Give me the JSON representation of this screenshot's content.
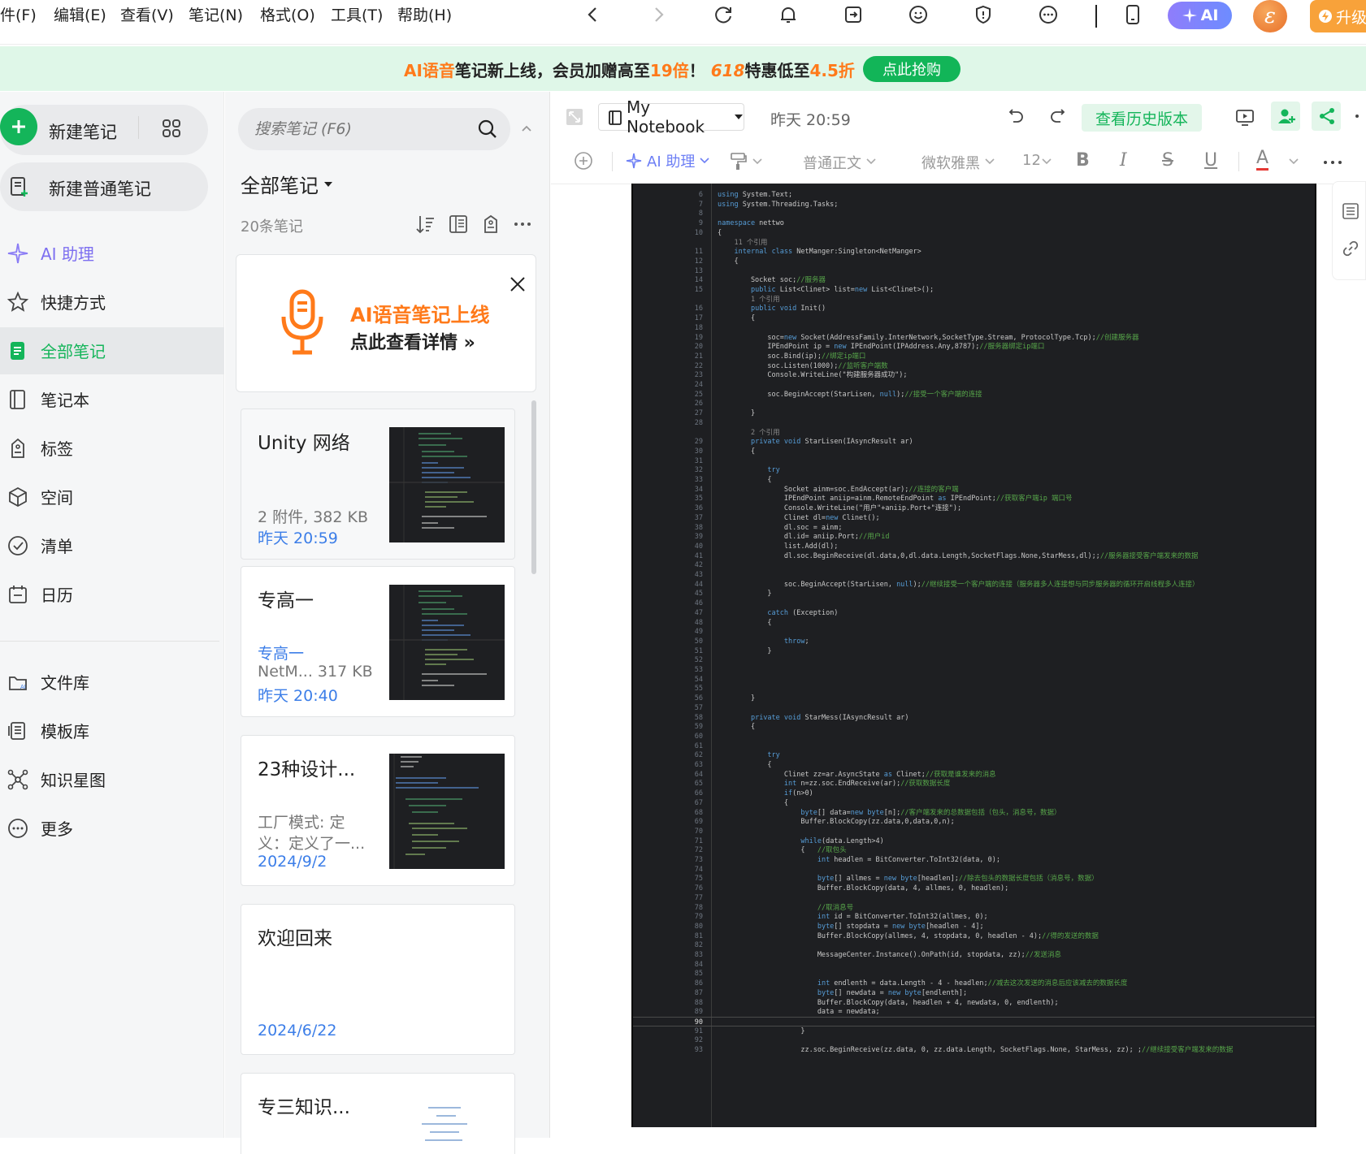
{
  "menubar": {
    "items": [
      "件(F)",
      "编辑(E)",
      "查看(V)",
      "笔记(N)",
      "格式(O)",
      "工具(T)",
      "帮助(H)"
    ],
    "ai_label": "AI",
    "avatar_letter": "ε",
    "upgrade_label": "升级"
  },
  "banner": {
    "part1": "AI语音",
    "part2": "笔记新上线，会员加赠高至",
    "part3": "19倍",
    "part4": "！",
    "part5": "618",
    "part6": "特惠低至",
    "part7": "4.5折",
    "button": "点此抢购"
  },
  "sidebar": {
    "new_note": "新建笔记",
    "new_plain_note": "新建普通笔记",
    "items": [
      {
        "label": "AI 助理",
        "icon": "sparkle-icon"
      },
      {
        "label": "快捷方式",
        "icon": "star-icon"
      },
      {
        "label": "全部笔记",
        "icon": "note-icon"
      },
      {
        "label": "笔记本",
        "icon": "notebook-icon"
      },
      {
        "label": "标签",
        "icon": "tag-icon"
      },
      {
        "label": "空间",
        "icon": "cube-icon"
      },
      {
        "label": "清单",
        "icon": "check-circle-icon"
      },
      {
        "label": "日历",
        "icon": "calendar-icon"
      },
      {
        "label": "文件库",
        "icon": "file-library-icon"
      },
      {
        "label": "模板库",
        "icon": "template-icon"
      },
      {
        "label": "知识星图",
        "icon": "knowledge-graph-icon"
      },
      {
        "label": "更多",
        "icon": "more-circle-icon"
      }
    ]
  },
  "notelist": {
    "search_placeholder": "搜索笔记 (F6)",
    "heading": "全部笔记",
    "count": "20条笔记",
    "promo": {
      "line1": "AI语音笔记上线",
      "line2": "点此查看详情 »"
    },
    "notes": [
      {
        "title": "Unity 网络",
        "meta": "2 附件, 382 KB",
        "meta2": "",
        "date": "昨天 20:59"
      },
      {
        "title": "专高一",
        "meta": "专高一",
        "meta2": "NetM... 317 KB",
        "date": "昨天 20:40"
      },
      {
        "title": "23种设计...",
        "meta": "工厂模式: 定",
        "meta2": "义：定义了一...",
        "date": "2024/9/2"
      },
      {
        "title": "欢迎回来",
        "meta": "",
        "meta2": "",
        "date": "2024/6/22"
      },
      {
        "title": "专三知识...",
        "meta": "",
        "meta2": "",
        "date": ""
      }
    ]
  },
  "editor": {
    "notebook": "My Notebook",
    "timestamp": "昨天 20:59",
    "history_button": "查看历史版本",
    "ai_assistant": "AI 助理",
    "paragraph_style": "普通正文",
    "font_family": "微软雅黑",
    "font_size": "12",
    "code": [
      [
        "6",
        "using System.Text;"
      ],
      [
        "7",
        "using System.Threading.Tasks;"
      ],
      [
        "8",
        ""
      ],
      [
        "9",
        "namespace nettwo"
      ],
      [
        "10",
        "{"
      ],
      [
        "",
        "    11 个引用"
      ],
      [
        "11",
        "    internal class NetManger:Singleton<NetManger>"
      ],
      [
        "12",
        "    {"
      ],
      [
        "13",
        ""
      ],
      [
        "14",
        "        Socket soc;//服务器"
      ],
      [
        "15",
        "        public List<Clinet> list=new List<Clinet>();"
      ],
      [
        "",
        "        1 个引用"
      ],
      [
        "16",
        "        public void Init()"
      ],
      [
        "17",
        "        {"
      ],
      [
        "18",
        ""
      ],
      [
        "19",
        "            soc=new Socket(AddressFamily.InterNetwork,SocketType.Stream, ProtocolType.Tcp);//创建服务器"
      ],
      [
        "20",
        "            IPEndPoint ip = new IPEndPoint(IPAddress.Any,8787);//服务器绑定ip端口"
      ],
      [
        "21",
        "            soc.Bind(ip);//绑定ip端口"
      ],
      [
        "22",
        "            soc.Listen(1000);//监听客户端数"
      ],
      [
        "23",
        "            Console.WriteLine(\"构建服务器成功\");"
      ],
      [
        "24",
        ""
      ],
      [
        "25",
        "            soc.BeginAccept(StarLisen, null);//接受一个客户端的连接"
      ],
      [
        "26",
        ""
      ],
      [
        "27",
        "        }"
      ],
      [
        "28",
        ""
      ],
      [
        "",
        "        2 个引用"
      ],
      [
        "29",
        "        private void StarLisen(IAsyncResult ar)"
      ],
      [
        "30",
        "        {"
      ],
      [
        "31",
        ""
      ],
      [
        "32",
        "            try"
      ],
      [
        "33",
        "            {"
      ],
      [
        "34",
        "                Socket ainm=soc.EndAccept(ar);//连接的客户端"
      ],
      [
        "35",
        "                IPEndPoint aniip=ainm.RemoteEndPoint as IPEndPoint;//获取客户端ip 端口号"
      ],
      [
        "36",
        "                Console.WriteLine(\"用户\"+aniip.Port+\"连接\");"
      ],
      [
        "37",
        "                Clinet dl=new Clinet();"
      ],
      [
        "38",
        "                dl.soc = ainm;"
      ],
      [
        "39",
        "                dl.id= aniip.Port;//用户id"
      ],
      [
        "40",
        "                list.Add(dl);"
      ],
      [
        "41",
        "                dl.soc.BeginReceive(dl.data,0,dl.data.Length,SocketFlags.None,StarMess,dl);;//服务器接受客户端发来的数据"
      ],
      [
        "42",
        ""
      ],
      [
        "43",
        ""
      ],
      [
        "44",
        "                soc.BeginAccept(StarLisen, null);//继续接受一个客户端的连接（服务器多人连接想与同步服务器的循环开启线程多人连接）"
      ],
      [
        "45",
        "            }"
      ],
      [
        "46",
        ""
      ],
      [
        "47",
        "            catch (Exception)"
      ],
      [
        "48",
        "            {"
      ],
      [
        "49",
        ""
      ],
      [
        "50",
        "                throw;"
      ],
      [
        "51",
        "            }"
      ],
      [
        "52",
        ""
      ],
      [
        "53",
        ""
      ],
      [
        "54",
        ""
      ],
      [
        "55",
        ""
      ],
      [
        "56",
        "        }"
      ],
      [
        "57",
        ""
      ],
      [
        "58",
        "        private void StarMess(IAsyncResult ar)"
      ],
      [
        "59",
        "        {"
      ],
      [
        "60",
        ""
      ],
      [
        "61",
        ""
      ],
      [
        "62",
        "            try"
      ],
      [
        "63",
        "            {"
      ],
      [
        "64",
        "                Clinet zz=ar.AsyncState as Clinet;//获取是谁发来的消息"
      ],
      [
        "65",
        "                int n=zz.soc.EndReceive(ar);//获取数据长度"
      ],
      [
        "66",
        "                if(n>0)"
      ],
      [
        "67",
        "                {"
      ],
      [
        "68",
        "                    byte[] data=new byte[n];//客户端发来的总数据包括（包头，消息号，数据）"
      ],
      [
        "69",
        "                    Buffer.BlockCopy(zz.data,0,data,0,n);"
      ],
      [
        "70",
        ""
      ],
      [
        "71",
        "                    while(data.Length>4)"
      ],
      [
        "72",
        "                    {   //取包头"
      ],
      [
        "73",
        "                        int headlen = BitConverter.ToInt32(data, 0);"
      ],
      [
        "74",
        ""
      ],
      [
        "75",
        "                        byte[] allmes = new byte[headlen];//除去包头的数据长度包括（消息号，数据）"
      ],
      [
        "76",
        "                        Buffer.BlockCopy(data, 4, allmes, 0, headlen);"
      ],
      [
        "77",
        ""
      ],
      [
        "78",
        "                        //取消息号"
      ],
      [
        "79",
        "                        int id = BitConverter.ToInt32(allmes, 0);"
      ],
      [
        "80",
        "                        byte[] stopdata = new byte[headlen - 4];"
      ],
      [
        "81",
        "                        Buffer.BlockCopy(allmes, 4, stopdata, 0, headlen - 4);//得的发送的数据"
      ],
      [
        "82",
        ""
      ],
      [
        "83",
        "                        MessageCenter.Instance().OnPath(id, stopdata, zz);//发送消息"
      ],
      [
        "84",
        ""
      ],
      [
        "85",
        ""
      ],
      [
        "86",
        "                        int endlenth = data.Length - 4 - headlen;//减去这次发送的消息后应该减去的数据长度"
      ],
      [
        "87",
        "                        byte[] newdata = new byte[endlenth];"
      ],
      [
        "88",
        "                        Buffer.BlockCopy(data, headlen + 4, newdata, 0, endlenth);"
      ],
      [
        "89",
        "                        data = newdata;"
      ],
      [
        "90",
        ""
      ],
      [
        "91",
        "                    }"
      ],
      [
        "92",
        ""
      ],
      [
        "93",
        "                    zz.soc.BeginReceive(zz.data, 0, zz.data.Length, SocketFlags.None, StarMess, zz); ;//继续接受客户端发来的数据"
      ]
    ]
  },
  "colors": {
    "brand_green": "#14b55a",
    "accent_orange": "#ff7a1a",
    "link_blue": "#3c7ee8",
    "code_bg": "#1e1f22"
  }
}
